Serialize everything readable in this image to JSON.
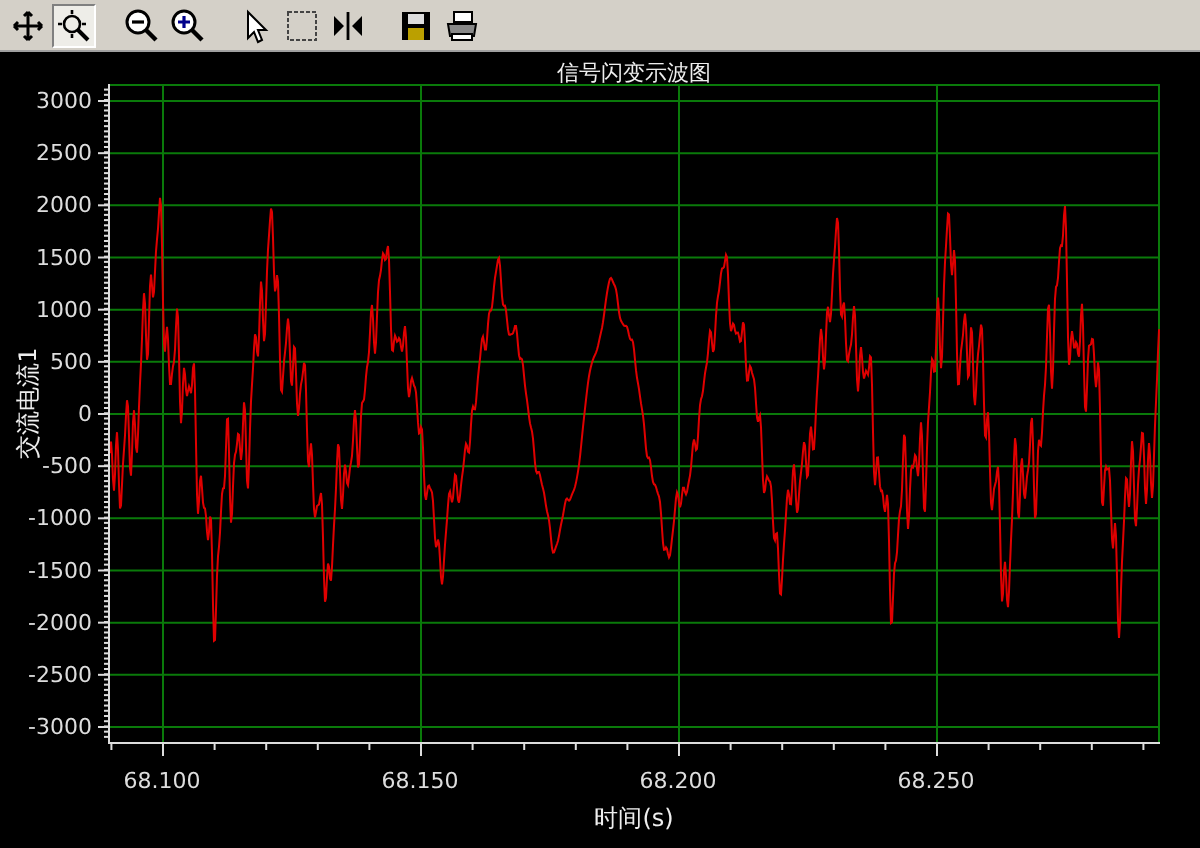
{
  "toolbar": {
    "tools": [
      {
        "kind": "move",
        "selected": false
      },
      {
        "kind": "zoom-box",
        "selected": true
      },
      {
        "kind": "zoom-out",
        "selected": false
      },
      {
        "kind": "zoom-in",
        "selected": false
      },
      {
        "kind": "pointer",
        "selected": false
      },
      {
        "kind": "select-rect",
        "selected": false
      },
      {
        "kind": "split",
        "selected": false
      },
      {
        "kind": "save",
        "selected": false
      },
      {
        "kind": "print",
        "selected": false
      }
    ]
  },
  "chart": {
    "title": "信号闪变示波图",
    "ylabel": "交流电流1",
    "xlabel": "时间(s)",
    "yticks": [
      "3000",
      "2500",
      "2000",
      "1500",
      "1000",
      "500",
      "0",
      "-500",
      "-1000",
      "-1500",
      "-2000",
      "-2500",
      "-3000"
    ],
    "xticks": [
      "68.100",
      "68.150",
      "68.200",
      "68.250"
    ]
  }
}
